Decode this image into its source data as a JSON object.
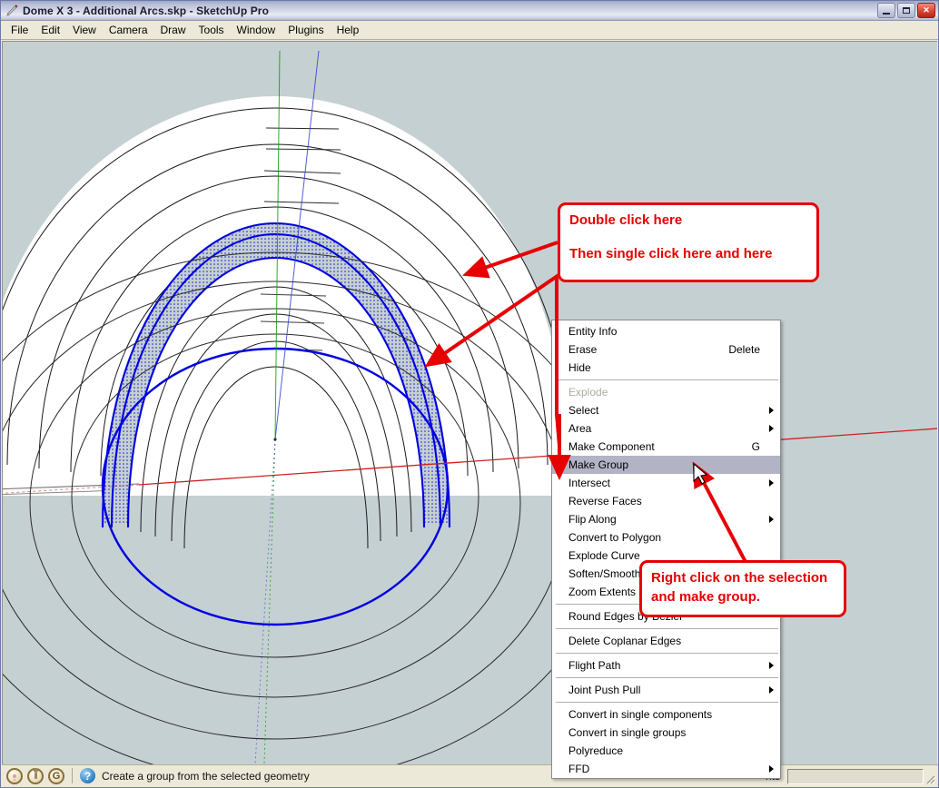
{
  "window": {
    "title": "Dome X 3 - Additional Arcs.skp - SketchUp Pro",
    "app_icon": "pencil-icon",
    "buttons": {
      "minimize": "minimize-button",
      "maximize": "maximize-button",
      "close": "close-button"
    }
  },
  "menubar": {
    "items": [
      {
        "label": "File"
      },
      {
        "label": "Edit"
      },
      {
        "label": "View"
      },
      {
        "label": "Camera"
      },
      {
        "label": "Draw"
      },
      {
        "label": "Tools"
      },
      {
        "label": "Window"
      },
      {
        "label": "Plugins"
      },
      {
        "label": "Help"
      }
    ]
  },
  "context_menu": {
    "groups": [
      {
        "items": [
          {
            "label": "Entity Info",
            "accel": "",
            "submenu": false,
            "disabled": false,
            "highlight": false
          },
          {
            "label": "Erase",
            "accel": "Delete",
            "submenu": false,
            "disabled": false,
            "highlight": false
          },
          {
            "label": "Hide",
            "accel": "",
            "submenu": false,
            "disabled": false,
            "highlight": false
          }
        ]
      },
      {
        "items": [
          {
            "label": "Explode",
            "accel": "",
            "submenu": false,
            "disabled": true,
            "highlight": false
          },
          {
            "label": "Select",
            "accel": "",
            "submenu": true,
            "disabled": false,
            "highlight": false
          },
          {
            "label": "Area",
            "accel": "",
            "submenu": true,
            "disabled": false,
            "highlight": false
          },
          {
            "label": "Make Component",
            "accel": "G",
            "submenu": false,
            "disabled": false,
            "highlight": false
          },
          {
            "label": "Make Group",
            "accel": "",
            "submenu": false,
            "disabled": false,
            "highlight": true
          },
          {
            "label": "Intersect",
            "accel": "",
            "submenu": true,
            "disabled": false,
            "highlight": false
          },
          {
            "label": "Reverse Faces",
            "accel": "",
            "submenu": false,
            "disabled": false,
            "highlight": false
          },
          {
            "label": "Flip Along",
            "accel": "",
            "submenu": true,
            "disabled": false,
            "highlight": false
          },
          {
            "label": "Convert to Polygon",
            "accel": "",
            "submenu": false,
            "disabled": false,
            "highlight": false
          },
          {
            "label": "Explode Curve",
            "accel": "",
            "submenu": false,
            "disabled": false,
            "highlight": false
          },
          {
            "label": "Soften/Smooth",
            "accel": "",
            "submenu": false,
            "disabled": false,
            "highlight": false
          },
          {
            "label": "Zoom Extents",
            "accel": "",
            "submenu": false,
            "disabled": false,
            "highlight": false
          }
        ]
      },
      {
        "items": [
          {
            "label": "Round Edges by Bezier",
            "accel": "",
            "submenu": false,
            "disabled": false,
            "highlight": false
          }
        ]
      },
      {
        "items": [
          {
            "label": "Delete Coplanar Edges",
            "accel": "",
            "submenu": false,
            "disabled": false,
            "highlight": false
          }
        ]
      },
      {
        "items": [
          {
            "label": "Flight Path",
            "accel": "",
            "submenu": true,
            "disabled": false,
            "highlight": false
          }
        ]
      },
      {
        "items": [
          {
            "label": "Joint Push Pull",
            "accel": "",
            "submenu": true,
            "disabled": false,
            "highlight": false
          }
        ]
      },
      {
        "items": [
          {
            "label": "Convert in single components",
            "accel": "",
            "submenu": false,
            "disabled": false,
            "highlight": false
          },
          {
            "label": "Convert in single groups",
            "accel": "",
            "submenu": false,
            "disabled": false,
            "highlight": false
          },
          {
            "label": "Polyreduce",
            "accel": "",
            "submenu": false,
            "disabled": false,
            "highlight": false
          },
          {
            "label": "FFD",
            "accel": "",
            "submenu": true,
            "disabled": false,
            "highlight": false
          }
        ]
      }
    ]
  },
  "callouts": [
    {
      "line1": "Double click here",
      "line2": "Then single click here and here"
    },
    {
      "line1": "Right click on the selection",
      "line2": "and make group."
    }
  ],
  "statusbar": {
    "icons": [
      "geo-location-pin-icon",
      "geo-person-icon",
      "google-g-icon",
      "help-question-icon"
    ],
    "google_letter": "G",
    "help_glyph": "?",
    "text": "Create a group from the selected geometry",
    "measurement_label": "nts",
    "measurement_value": ""
  },
  "colors": {
    "viewport_background": "#c5d0d2",
    "selection_blue": "#0000e0",
    "annotation_red": "#e60000",
    "menu_highlight": "#b3b3c6",
    "face_white": "#ffffff",
    "axis_red": "#cc2222",
    "axis_green": "#119911",
    "axis_blue": "#3344cc"
  }
}
